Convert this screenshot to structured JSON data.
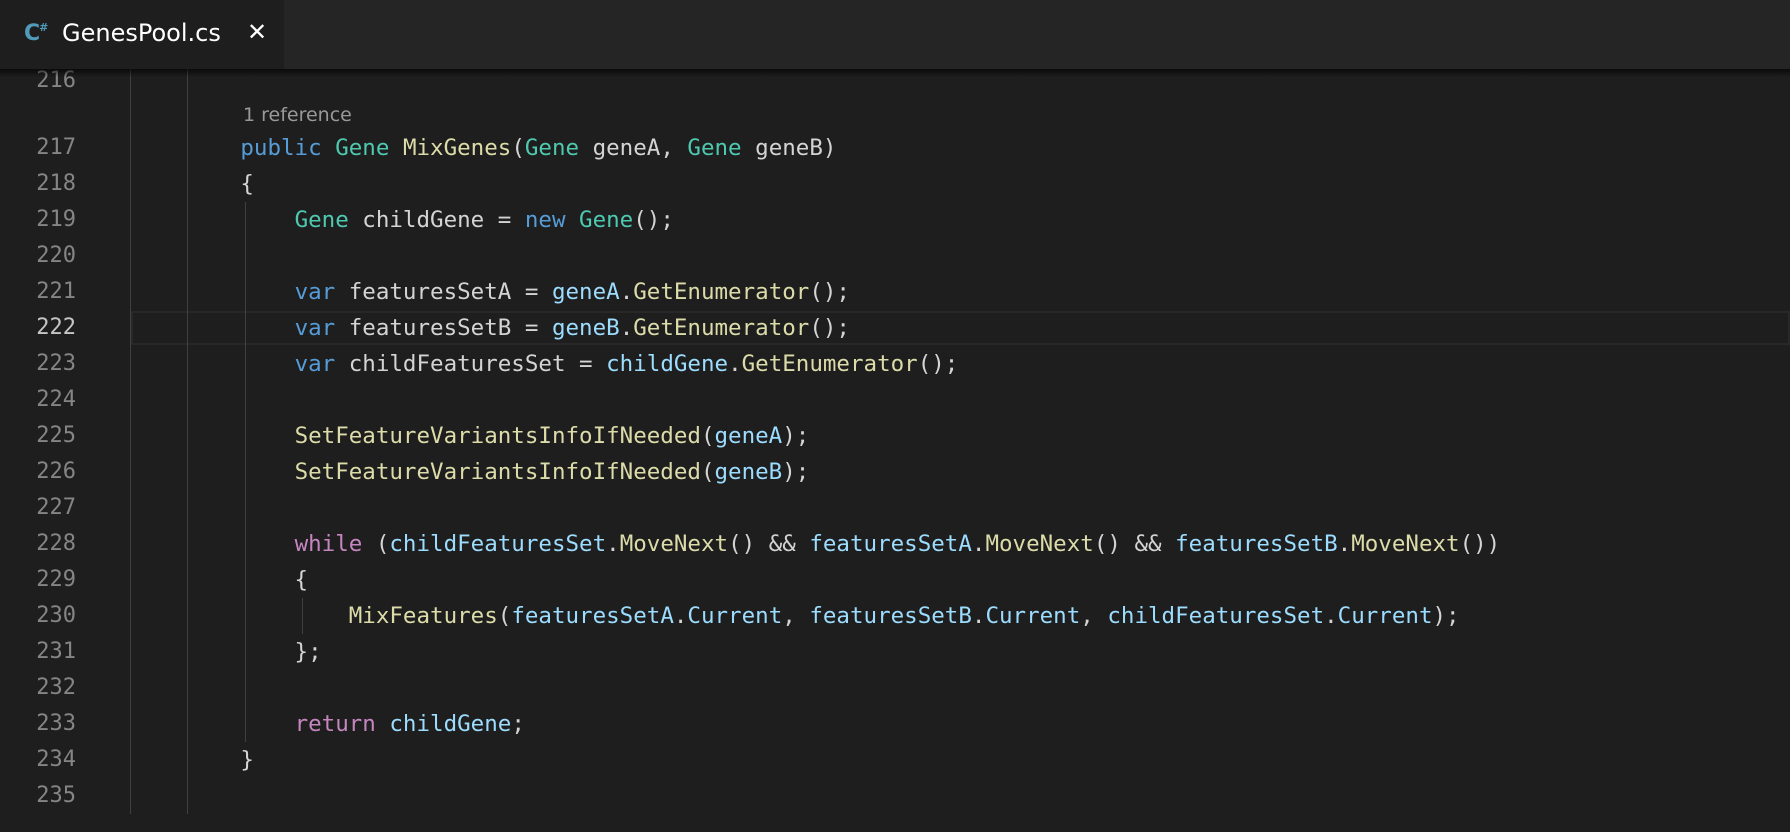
{
  "tab": {
    "lang_icon": "C#",
    "lang_icon_name": "csharp-file-icon",
    "filename": "GenesPool.cs",
    "close_glyph": "✕"
  },
  "editor": {
    "active_line": 222,
    "codelens": {
      "before_line": 217,
      "text": "1 reference"
    },
    "lines": [
      {
        "n": 216,
        "tokens": []
      },
      {
        "n": 217,
        "tokens": [
          [
            "        ",
            "pl"
          ],
          [
            "public",
            "kw"
          ],
          [
            " ",
            "pl"
          ],
          [
            "Gene",
            "typ"
          ],
          [
            " ",
            "pl"
          ],
          [
            "MixGenes",
            "fn"
          ],
          [
            "(",
            "pl"
          ],
          [
            "Gene",
            "typ"
          ],
          [
            " geneA, ",
            "pl"
          ],
          [
            "Gene",
            "typ"
          ],
          [
            " geneB)",
            "pl"
          ]
        ]
      },
      {
        "n": 218,
        "tokens": [
          [
            "        {",
            "pl"
          ]
        ]
      },
      {
        "n": 219,
        "tokens": [
          [
            "            ",
            "pl"
          ],
          [
            "Gene",
            "typ"
          ],
          [
            " childGene = ",
            "pl"
          ],
          [
            "new",
            "kw"
          ],
          [
            " ",
            "pl"
          ],
          [
            "Gene",
            "typ"
          ],
          [
            "();",
            "pl"
          ]
        ]
      },
      {
        "n": 220,
        "tokens": []
      },
      {
        "n": 221,
        "tokens": [
          [
            "            ",
            "pl"
          ],
          [
            "var",
            "kw"
          ],
          [
            " featuresSetA = ",
            "pl"
          ],
          [
            "geneA",
            "var"
          ],
          [
            ".",
            "pl"
          ],
          [
            "GetEnumerator",
            "fn"
          ],
          [
            "();",
            "pl"
          ]
        ]
      },
      {
        "n": 222,
        "tokens": [
          [
            "            ",
            "pl"
          ],
          [
            "var",
            "kw"
          ],
          [
            " featuresSetB = ",
            "pl"
          ],
          [
            "geneB",
            "var"
          ],
          [
            ".",
            "pl"
          ],
          [
            "GetEnumerator",
            "fn"
          ],
          [
            "();",
            "pl"
          ]
        ]
      },
      {
        "n": 223,
        "tokens": [
          [
            "            ",
            "pl"
          ],
          [
            "var",
            "kw"
          ],
          [
            " childFeaturesSet = ",
            "pl"
          ],
          [
            "childGene",
            "var"
          ],
          [
            ".",
            "pl"
          ],
          [
            "GetEnumerator",
            "fn"
          ],
          [
            "();",
            "pl"
          ]
        ]
      },
      {
        "n": 224,
        "tokens": []
      },
      {
        "n": 225,
        "tokens": [
          [
            "            ",
            "pl"
          ],
          [
            "SetFeatureVariantsInfoIfNeeded",
            "fn"
          ],
          [
            "(",
            "pl"
          ],
          [
            "geneA",
            "var"
          ],
          [
            ");",
            "pl"
          ]
        ]
      },
      {
        "n": 226,
        "tokens": [
          [
            "            ",
            "pl"
          ],
          [
            "SetFeatureVariantsInfoIfNeeded",
            "fn"
          ],
          [
            "(",
            "pl"
          ],
          [
            "geneB",
            "var"
          ],
          [
            ");",
            "pl"
          ]
        ]
      },
      {
        "n": 227,
        "tokens": []
      },
      {
        "n": 228,
        "tokens": [
          [
            "            ",
            "pl"
          ],
          [
            "while",
            "ctl"
          ],
          [
            " (",
            "pl"
          ],
          [
            "childFeaturesSet",
            "var"
          ],
          [
            ".",
            "pl"
          ],
          [
            "MoveNext",
            "fn"
          ],
          [
            "() && ",
            "pl"
          ],
          [
            "featuresSetA",
            "var"
          ],
          [
            ".",
            "pl"
          ],
          [
            "MoveNext",
            "fn"
          ],
          [
            "() && ",
            "pl"
          ],
          [
            "featuresSetB",
            "var"
          ],
          [
            ".",
            "pl"
          ],
          [
            "MoveNext",
            "fn"
          ],
          [
            "())",
            "pl"
          ]
        ]
      },
      {
        "n": 229,
        "tokens": [
          [
            "            {",
            "pl"
          ]
        ]
      },
      {
        "n": 230,
        "tokens": [
          [
            "                ",
            "pl"
          ],
          [
            "MixFeatures",
            "fn"
          ],
          [
            "(",
            "pl"
          ],
          [
            "featuresSetA",
            "var"
          ],
          [
            ".",
            "pl"
          ],
          [
            "Current",
            "var"
          ],
          [
            ", ",
            "pl"
          ],
          [
            "featuresSetB",
            "var"
          ],
          [
            ".",
            "pl"
          ],
          [
            "Current",
            "var"
          ],
          [
            ", ",
            "pl"
          ],
          [
            "childFeaturesSet",
            "var"
          ],
          [
            ".",
            "pl"
          ],
          [
            "Current",
            "var"
          ],
          [
            ");",
            "pl"
          ]
        ]
      },
      {
        "n": 231,
        "tokens": [
          [
            "            };",
            "pl"
          ]
        ]
      },
      {
        "n": 232,
        "tokens": []
      },
      {
        "n": 233,
        "tokens": [
          [
            "            ",
            "pl"
          ],
          [
            "return",
            "ctl"
          ],
          [
            " ",
            "pl"
          ],
          [
            "childGene",
            "var"
          ],
          [
            ";",
            "pl"
          ]
        ]
      },
      {
        "n": 234,
        "tokens": [
          [
            "        }",
            "pl"
          ]
        ]
      },
      {
        "n": 235,
        "tokens": []
      }
    ]
  }
}
